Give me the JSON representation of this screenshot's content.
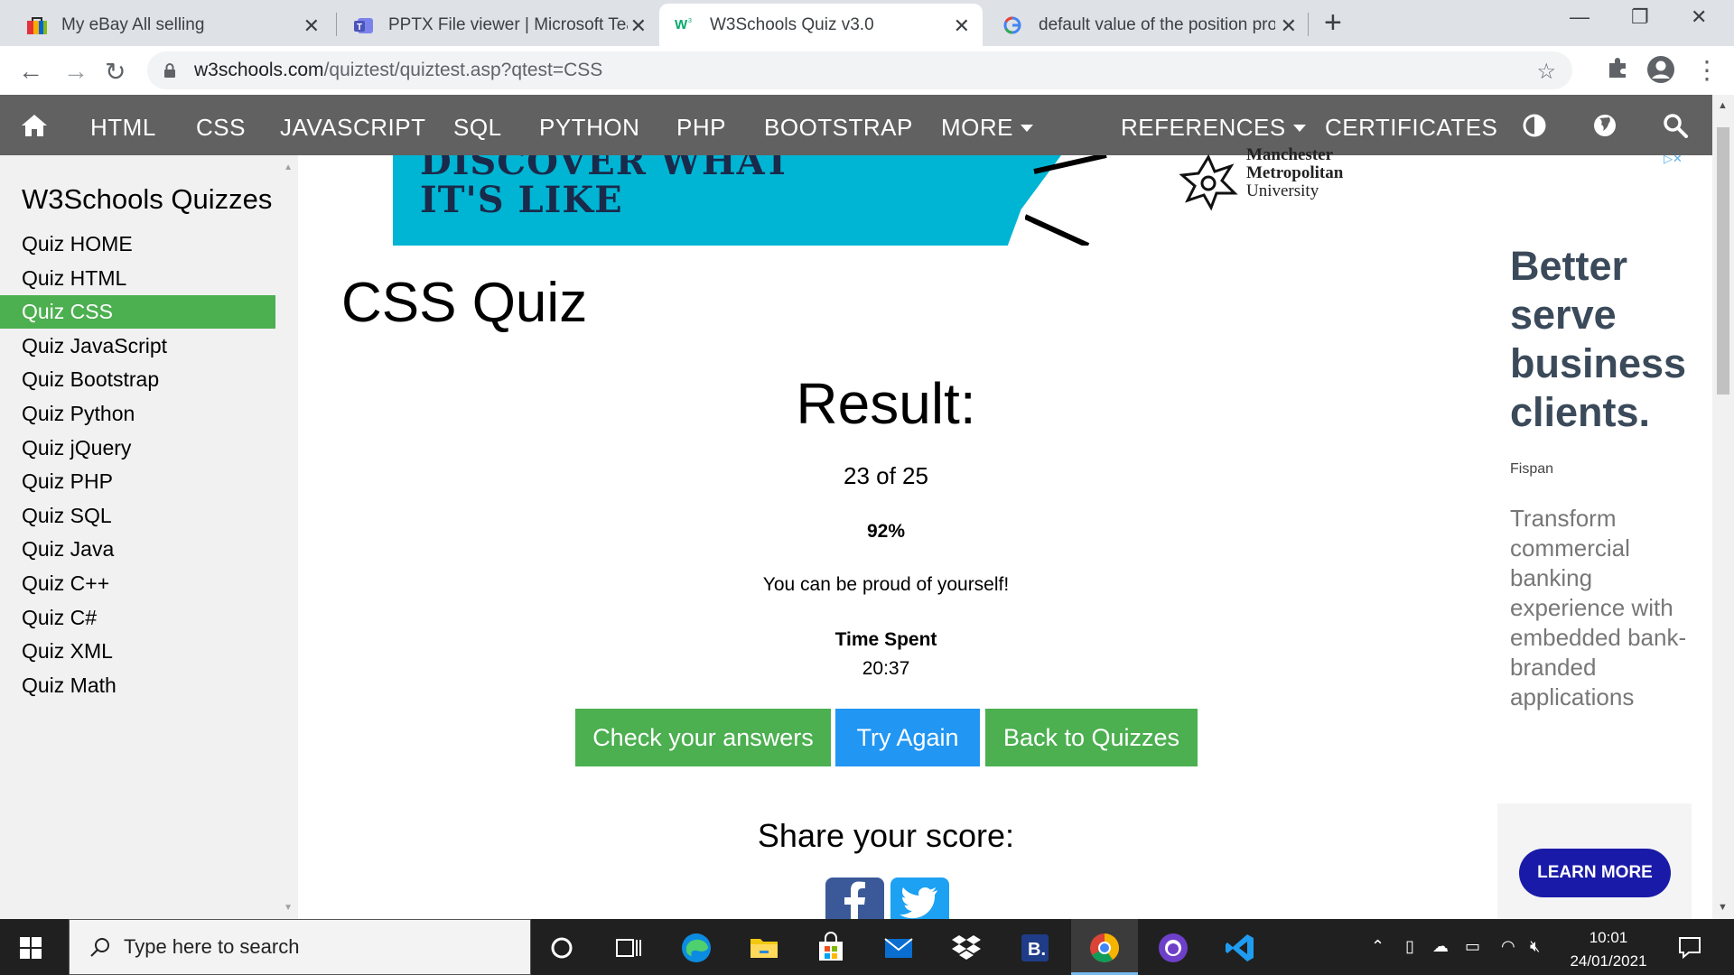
{
  "browser": {
    "tabs": [
      {
        "title": "My eBay All selling"
      },
      {
        "title": "PPTX File viewer | Microsoft Team"
      },
      {
        "title": "W3Schools Quiz v3.0"
      },
      {
        "title": "default value of the position prop"
      }
    ],
    "url_host": "w3schools.com",
    "url_path": "/quiztest/quiztest.asp?qtest=CSS"
  },
  "w3nav": {
    "items": [
      "HTML",
      "CSS",
      "JAVASCRIPT",
      "SQL",
      "PYTHON",
      "PHP",
      "BOOTSTRAP",
      "MORE",
      "REFERENCES",
      "CERTIFICATES"
    ]
  },
  "sidebar": {
    "title": "W3Schools Quizzes",
    "links": [
      "Quiz HOME",
      "Quiz HTML",
      "Quiz CSS",
      "Quiz JavaScript",
      "Quiz Bootstrap",
      "Quiz Python",
      "Quiz jQuery",
      "Quiz PHP",
      "Quiz SQL",
      "Quiz Java",
      "Quiz C++",
      "Quiz C#",
      "Quiz XML",
      "Quiz Math"
    ],
    "active_index": 2
  },
  "banner_ad": {
    "line1": "DISCOVER WHAT",
    "line2": "IT'S LIKE",
    "org_line1": "Manchester",
    "org_line2": "Metropolitan",
    "org_line3": "University"
  },
  "main": {
    "page_title": "CSS Quiz",
    "result_heading": "Result:",
    "score": "23 of 25",
    "percent": "92%",
    "message": "You can be proud of yourself!",
    "time_label": "Time Spent",
    "time_value": "20:37",
    "buttons": {
      "check": "Check your answers",
      "retry": "Try Again",
      "back": "Back to Quizzes"
    },
    "share_heading": "Share your score:"
  },
  "side_ad": {
    "headline": "Better serve business clients.",
    "brand": "Fispan",
    "body": "Transform commercial banking experience with embedded bank-branded applications",
    "cta": "LEARN MORE"
  },
  "taskbar": {
    "search_placeholder": "Type here to search",
    "time": "10:01",
    "date": "24/01/2021",
    "apps": [
      "cortana-icon",
      "task-view-icon",
      "edge-icon",
      "file-explorer-icon",
      "store-icon",
      "mail-icon",
      "dropbox-icon",
      "b-app-icon",
      "chrome-icon",
      "github-icon",
      "vscode-icon"
    ]
  },
  "colors": {
    "w3_green": "#4caf50",
    "w3_blue": "#2196f3",
    "w3_nav": "#616161",
    "ad_cta": "#1a1aa8"
  }
}
